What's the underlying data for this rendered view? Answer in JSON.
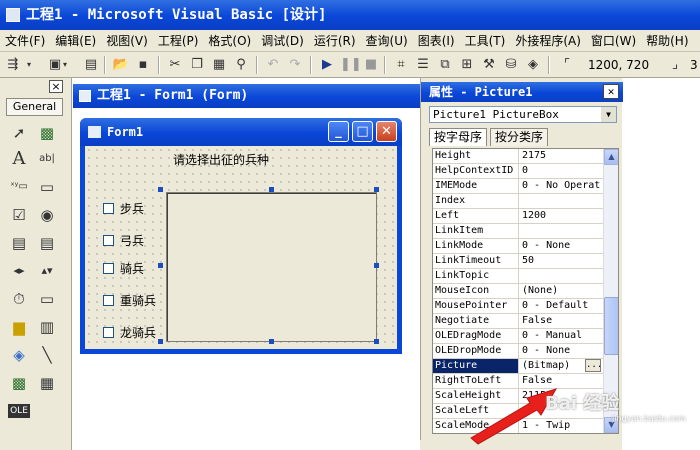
{
  "app": {
    "title": "工程1 - Microsoft Visual Basic [设计]",
    "menu": [
      "文件(F)",
      "编辑(E)",
      "视图(V)",
      "工程(P)",
      "格式(O)",
      "调试(D)",
      "运行(R)",
      "查询(U)",
      "图表(I)",
      "工具(T)",
      "外接程序(A)",
      "窗口(W)",
      "帮助(H)"
    ],
    "toolbar_coords": "1200, 720",
    "toolbar_coords_tail": "3"
  },
  "toolbox": {
    "tab_label": "General",
    "close_glyph": "×",
    "tools": [
      "pointer",
      "picturebox",
      "label",
      "textbox",
      "frame",
      "commandbutton",
      "checkbox",
      "optionbutton",
      "combobox",
      "listbox",
      "hscrollbar",
      "vscrollbar",
      "timer",
      "drivelistbox",
      "dirlistbox",
      "filelistbox",
      "shape",
      "line",
      "image",
      "data",
      "ole"
    ]
  },
  "mdi": {
    "title": "工程1 - Form1 (Form)"
  },
  "form": {
    "title": "Form1",
    "caption": "请选择出征的兵种",
    "checkboxes": [
      "步兵",
      "弓兵",
      "骑兵",
      "重骑兵",
      "龙骑兵"
    ]
  },
  "properties": {
    "title": "属性 - Picture1",
    "object": "Picture1 PictureBox",
    "tabs": [
      "按字母序",
      "按分类序"
    ],
    "rows": [
      {
        "name": "Height",
        "value": "2175"
      },
      {
        "name": "HelpContextID",
        "value": "0"
      },
      {
        "name": "IMEMode",
        "value": "0 - No Operat"
      },
      {
        "name": "Index",
        "value": ""
      },
      {
        "name": "Left",
        "value": "1200"
      },
      {
        "name": "LinkItem",
        "value": ""
      },
      {
        "name": "LinkMode",
        "value": "0 - None"
      },
      {
        "name": "LinkTimeout",
        "value": "50"
      },
      {
        "name": "LinkTopic",
        "value": ""
      },
      {
        "name": "MouseIcon",
        "value": "(None)"
      },
      {
        "name": "MousePointer",
        "value": "0 - Default"
      },
      {
        "name": "Negotiate",
        "value": "False"
      },
      {
        "name": "OLEDragMode",
        "value": "0 - Manual"
      },
      {
        "name": "OLEDropMode",
        "value": "0 - None"
      },
      {
        "name": "Picture",
        "value": "(Bitmap)"
      },
      {
        "name": "RightToLeft",
        "value": "False"
      },
      {
        "name": "ScaleHeight",
        "value": "2115"
      },
      {
        "name": "ScaleLeft",
        "value": "0"
      },
      {
        "name": "ScaleMode",
        "value": "1 - Twip"
      }
    ],
    "selected_row": 14,
    "ellipsis_label": "..."
  },
  "annotation": {
    "arrow_color": "#e8201c",
    "watermark": "Bai 经验",
    "watermark_sub": "jingyan.baidu.com"
  }
}
